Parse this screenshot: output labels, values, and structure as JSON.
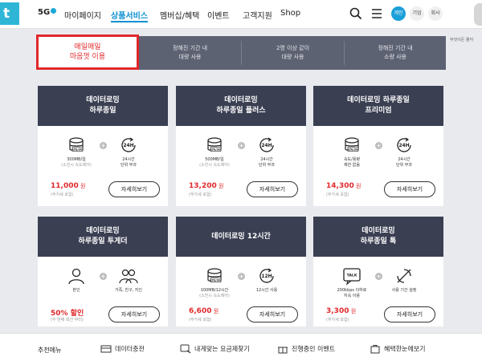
{
  "header": {
    "logo_left": "t",
    "brand": "5G",
    "nav": [
      "마이페이지",
      "상품서비스",
      "멤버십/혜택",
      "이벤트",
      "고객지원",
      "Shop"
    ],
    "segments": [
      "개인",
      "기업",
      "회사"
    ],
    "side_note": "무엇이든 물어"
  },
  "tabs": [
    {
      "line1": "매일매일",
      "line2": "마음껏 이용"
    },
    {
      "line1": "정해진 기간 내",
      "line2": "대량 사용"
    },
    {
      "line1": "2명 이상 같이",
      "line2": "대량 사용"
    },
    {
      "line1": "정해진 기간 내",
      "line2": "소량 사용"
    }
  ],
  "cards": [
    {
      "title1": "데이터로밍",
      "title2": "하루종일",
      "icon_a": "data-db-icon",
      "icon_a_badge": "LTE/3G",
      "cap_a1": "300MB/일",
      "cap_a2": "(소진시 속도제어)",
      "icon_b": "24h-icon",
      "icon_b_text": "24H",
      "cap_b1": "24시간",
      "cap_b2": "단위 부과",
      "price": "11,000",
      "unit": "원",
      "vat": "(부가세 포함)",
      "button": "자세히보기"
    },
    {
      "title1": "데이터로밍",
      "title2": "하루종일 플러스",
      "icon_a": "data-db-icon",
      "icon_a_badge": "LTE/3G",
      "cap_a1": "500MB/일",
      "cap_a2": "(소진시 속도제어)",
      "icon_b": "24h-icon",
      "icon_b_text": "24H",
      "cap_b1": "24시간",
      "cap_b2": "단위 부과",
      "price": "13,200",
      "unit": "원",
      "vat": "(부가세 포함)",
      "button": "자세히보기"
    },
    {
      "title1": "데이터로밍 하루종일",
      "title2": "프리미엄",
      "icon_a": "data-db-icon",
      "icon_a_badge": "LTE/3G",
      "cap_a1": "속도/용량",
      "cap_a2": "제한 없음",
      "icon_b": "24h-icon",
      "icon_b_text": "24H",
      "cap_b1": "24시간",
      "cap_b2": "단위 부과",
      "price": "14,300",
      "unit": "원",
      "vat": "(부가세 포함)",
      "button": "자세히보기"
    },
    {
      "title1": "데이터로밍",
      "title2": "하루종일 투게더",
      "icon_a": "person-icon",
      "icon_a_badge": "",
      "cap_a1": "본인",
      "cap_a2": "",
      "icon_b": "group-icon",
      "icon_b_text": "",
      "cap_b1": "가족, 친구, 지인",
      "cap_b2": "",
      "price": "50% 할인",
      "unit": "",
      "vat": "(두 번째 회선 부터)",
      "button": "자세히보기"
    },
    {
      "title1": "데이터로밍 12시간",
      "title2": "",
      "icon_a": "data-db-icon",
      "icon_a_badge": "LTE/3G",
      "cap_a1": "100MB/12시간",
      "cap_a2": "(소진시 속도제어)",
      "icon_b": "12h-icon",
      "icon_b_text": "12H",
      "cap_b1": "12시간 사용",
      "cap_b2": "",
      "price": "6,600",
      "unit": "원",
      "vat": "(부가세 포함)",
      "button": "자세히보기"
    },
    {
      "title1": "데이터로밍",
      "title2": "하루종일 톡",
      "icon_a": "talk-icon",
      "icon_a_badge": "TALK",
      "cap_a1": "200kbps 이하로",
      "cap_a2": "지속 이용",
      "icon_b": "no-sync-icon",
      "icon_b_text": "",
      "cap_b1": "사용 기간 설정",
      "cap_b2": "",
      "price": "3,300",
      "unit": "원",
      "vat": "(부가세 포함)",
      "button": "자세히보기"
    }
  ],
  "bottom": {
    "title": "추천메뉴",
    "items": [
      "데이터충전",
      "내게맞는 요금제찾기",
      "진행중인 이벤트",
      "혜택한눈에보기"
    ]
  },
  "colors": {
    "accent": "#0a8fd0",
    "red": "#e0282b",
    "card_head": "#3a3f52",
    "tab_bg": "#5d6273",
    "page_bg": "#e9eaee"
  }
}
